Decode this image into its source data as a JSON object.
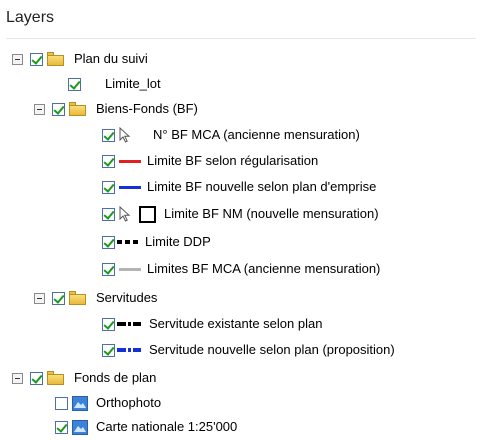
{
  "panel": {
    "title": "Layers"
  },
  "tree": {
    "plan_du_suivi": {
      "label": "Plan du suivi",
      "checked": true
    },
    "limite_lot": {
      "label": "Limite_lot",
      "checked": true
    },
    "biens_fonds": {
      "label": "Biens-Fonds (BF)",
      "checked": true
    },
    "bf_mca_num": {
      "label": "N° BF MCA (ancienne mensuration)",
      "checked": true
    },
    "bf_regularisation": {
      "label": "Limite BF selon régularisation",
      "checked": true,
      "color": "#e02020"
    },
    "bf_emprise": {
      "label": "Limite BF nouvelle selon plan d'emprise",
      "checked": true,
      "color": "#1530d8"
    },
    "bf_nm": {
      "label": "Limite BF NM (nouvelle mensuration)",
      "checked": true
    },
    "limite_ddp": {
      "label": "Limite DDP",
      "checked": true
    },
    "bf_mca": {
      "label": "Limites BF MCA (ancienne mensuration)",
      "checked": true,
      "color": "#b4b4b4"
    },
    "servitudes": {
      "label": "Servitudes",
      "checked": true
    },
    "serv_existante": {
      "label": "Servitude existante selon plan",
      "checked": true
    },
    "serv_nouvelle": {
      "label": "Servitude nouvelle selon plan (proposition)",
      "checked": true
    },
    "fonds_de_plan": {
      "label": "Fonds de plan",
      "checked": true
    },
    "orthophoto": {
      "label": "Orthophoto",
      "checked": false
    },
    "carte_nationale": {
      "label": "Carte nationale 1:25'000",
      "checked": true
    }
  }
}
